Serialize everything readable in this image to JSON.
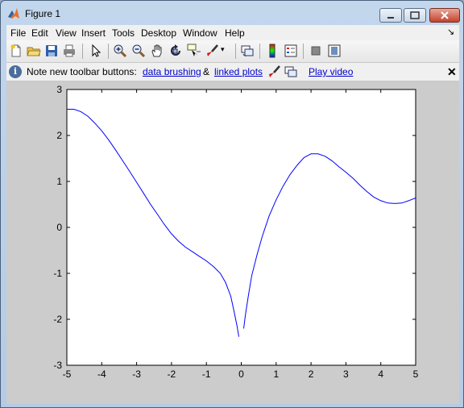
{
  "window": {
    "title": "Figure 1"
  },
  "menu": [
    "File",
    "Edit",
    "View",
    "Insert",
    "Tools",
    "Desktop",
    "Window",
    "Help"
  ],
  "toolbar_icons": [
    "new-figure-icon",
    "open-file-icon",
    "save-icon",
    "print-icon",
    "edit-plot-arrow-icon",
    "zoom-in-icon",
    "zoom-out-icon",
    "pan-hand-icon",
    "rotate-3d-icon",
    "data-cursor-icon",
    "brush-icon",
    "link-plot-icon",
    "colorbar-icon",
    "legend-icon",
    "hide-plot-tools-icon",
    "show-plot-tools-icon"
  ],
  "infobar": {
    "message": "Note new toolbar buttons:",
    "link_brushing": "data brushing",
    "ampersand": "&",
    "link_linked": "linked plots",
    "link_video": "Play video"
  },
  "colors": {
    "line": "#0000ff",
    "link": "#0000cc",
    "figure_bg": "#cccccc"
  },
  "chart_data": {
    "type": "line",
    "xlim": [
      -5,
      5
    ],
    "ylim": [
      -3,
      3
    ],
    "x_ticks": [
      -5,
      -4,
      -3,
      -2,
      -1,
      0,
      1,
      2,
      3,
      4,
      5
    ],
    "y_ticks": [
      -3,
      -2,
      -1,
      0,
      1,
      2,
      3
    ],
    "grid": false,
    "series": [
      {
        "segments": [
          [
            [
              -5.0,
              2.57
            ],
            [
              -4.8,
              2.57
            ],
            [
              -4.6,
              2.52
            ],
            [
              -4.4,
              2.42
            ],
            [
              -4.2,
              2.27
            ],
            [
              -4.0,
              2.1
            ],
            [
              -3.8,
              1.9
            ],
            [
              -3.6,
              1.68
            ],
            [
              -3.4,
              1.45
            ],
            [
              -3.2,
              1.22
            ],
            [
              -3.0,
              0.98
            ],
            [
              -2.8,
              0.74
            ],
            [
              -2.6,
              0.5
            ],
            [
              -2.4,
              0.28
            ],
            [
              -2.2,
              0.06
            ],
            [
              -2.0,
              -0.14
            ],
            [
              -1.8,
              -0.3
            ],
            [
              -1.6,
              -0.43
            ],
            [
              -1.4,
              -0.53
            ],
            [
              -1.2,
              -0.63
            ],
            [
              -1.0,
              -0.73
            ],
            [
              -0.8,
              -0.85
            ],
            [
              -0.6,
              -1.0
            ],
            [
              -0.45,
              -1.2
            ],
            [
              -0.3,
              -1.5
            ],
            [
              -0.2,
              -1.85
            ],
            [
              -0.12,
              -2.15
            ],
            [
              -0.07,
              -2.38
            ]
          ],
          [
            [
              0.07,
              -2.2
            ],
            [
              0.12,
              -1.9
            ],
            [
              0.2,
              -1.5
            ],
            [
              0.3,
              -1.05
            ],
            [
              0.45,
              -0.6
            ],
            [
              0.6,
              -0.2
            ],
            [
              0.8,
              0.25
            ],
            [
              1.0,
              0.6
            ],
            [
              1.2,
              0.9
            ],
            [
              1.4,
              1.15
            ],
            [
              1.6,
              1.35
            ],
            [
              1.8,
              1.52
            ],
            [
              2.0,
              1.6
            ],
            [
              2.2,
              1.6
            ],
            [
              2.4,
              1.55
            ],
            [
              2.6,
              1.45
            ],
            [
              2.8,
              1.32
            ],
            [
              3.0,
              1.2
            ],
            [
              3.2,
              1.07
            ],
            [
              3.4,
              0.92
            ],
            [
              3.6,
              0.78
            ],
            [
              3.8,
              0.66
            ],
            [
              4.0,
              0.58
            ],
            [
              4.2,
              0.53
            ],
            [
              4.4,
              0.52
            ],
            [
              4.6,
              0.53
            ],
            [
              4.8,
              0.58
            ],
            [
              5.0,
              0.64
            ]
          ]
        ]
      }
    ]
  }
}
